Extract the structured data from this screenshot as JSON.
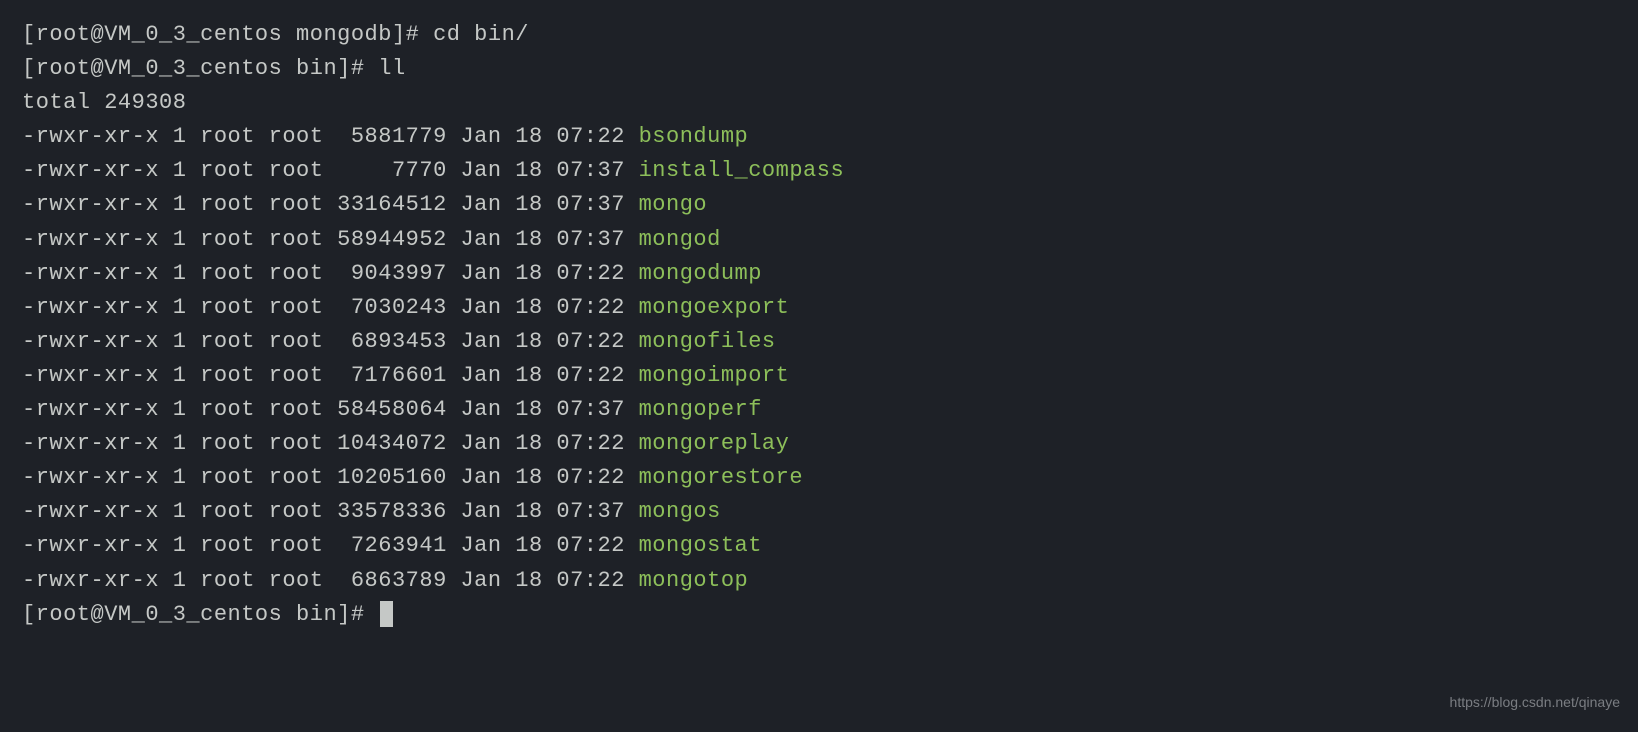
{
  "prompts": [
    {
      "text": "[root@VM_0_3_centos mongodb]# ",
      "cmd": "cd bin/"
    },
    {
      "text": "[root@VM_0_3_centos bin]# ",
      "cmd": "ll"
    }
  ],
  "total": "total 249308",
  "files": [
    {
      "perms": "-rwxr-xr-x",
      "links": "1",
      "owner": "root",
      "group": "root",
      "size": "5881779",
      "month": "Jan",
      "day": "18",
      "time": "07:22",
      "name": "bsondump"
    },
    {
      "perms": "-rwxr-xr-x",
      "links": "1",
      "owner": "root",
      "group": "root",
      "size": "7770",
      "month": "Jan",
      "day": "18",
      "time": "07:37",
      "name": "install_compass"
    },
    {
      "perms": "-rwxr-xr-x",
      "links": "1",
      "owner": "root",
      "group": "root",
      "size": "33164512",
      "month": "Jan",
      "day": "18",
      "time": "07:37",
      "name": "mongo"
    },
    {
      "perms": "-rwxr-xr-x",
      "links": "1",
      "owner": "root",
      "group": "root",
      "size": "58944952",
      "month": "Jan",
      "day": "18",
      "time": "07:37",
      "name": "mongod"
    },
    {
      "perms": "-rwxr-xr-x",
      "links": "1",
      "owner": "root",
      "group": "root",
      "size": "9043997",
      "month": "Jan",
      "day": "18",
      "time": "07:22",
      "name": "mongodump"
    },
    {
      "perms": "-rwxr-xr-x",
      "links": "1",
      "owner": "root",
      "group": "root",
      "size": "7030243",
      "month": "Jan",
      "day": "18",
      "time": "07:22",
      "name": "mongoexport"
    },
    {
      "perms": "-rwxr-xr-x",
      "links": "1",
      "owner": "root",
      "group": "root",
      "size": "6893453",
      "month": "Jan",
      "day": "18",
      "time": "07:22",
      "name": "mongofiles"
    },
    {
      "perms": "-rwxr-xr-x",
      "links": "1",
      "owner": "root",
      "group": "root",
      "size": "7176601",
      "month": "Jan",
      "day": "18",
      "time": "07:22",
      "name": "mongoimport"
    },
    {
      "perms": "-rwxr-xr-x",
      "links": "1",
      "owner": "root",
      "group": "root",
      "size": "58458064",
      "month": "Jan",
      "day": "18",
      "time": "07:37",
      "name": "mongoperf"
    },
    {
      "perms": "-rwxr-xr-x",
      "links": "1",
      "owner": "root",
      "group": "root",
      "size": "10434072",
      "month": "Jan",
      "day": "18",
      "time": "07:22",
      "name": "mongoreplay"
    },
    {
      "perms": "-rwxr-xr-x",
      "links": "1",
      "owner": "root",
      "group": "root",
      "size": "10205160",
      "month": "Jan",
      "day": "18",
      "time": "07:22",
      "name": "mongorestore"
    },
    {
      "perms": "-rwxr-xr-x",
      "links": "1",
      "owner": "root",
      "group": "root",
      "size": "33578336",
      "month": "Jan",
      "day": "18",
      "time": "07:37",
      "name": "mongos"
    },
    {
      "perms": "-rwxr-xr-x",
      "links": "1",
      "owner": "root",
      "group": "root",
      "size": "7263941",
      "month": "Jan",
      "day": "18",
      "time": "07:22",
      "name": "mongostat"
    },
    {
      "perms": "-rwxr-xr-x",
      "links": "1",
      "owner": "root",
      "group": "root",
      "size": "6863789",
      "month": "Jan",
      "day": "18",
      "time": "07:22",
      "name": "mongotop"
    }
  ],
  "final_prompt": "[root@VM_0_3_centos bin]# ",
  "watermark": "https://blog.csdn.net/qinaye"
}
